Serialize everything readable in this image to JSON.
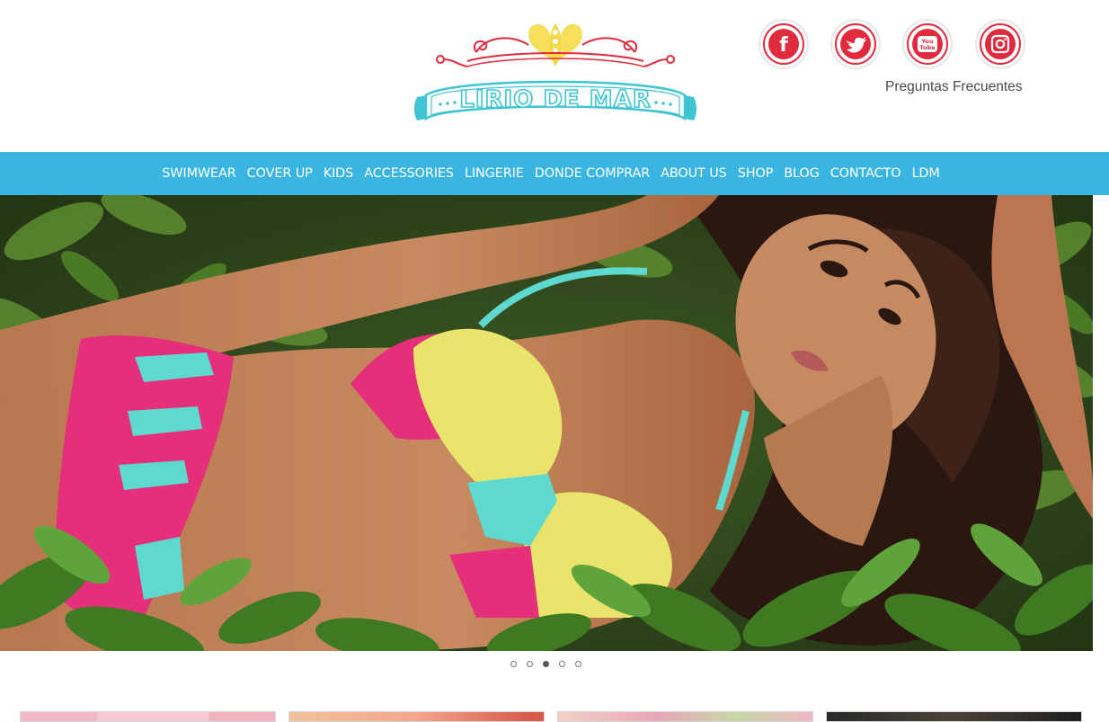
{
  "brand": {
    "logo_text": "LIRIO DE MAR",
    "colors": {
      "red": "#e02b3f",
      "yellow": "#f6e05b",
      "turquoise": "#3fc4d2"
    }
  },
  "social": [
    {
      "icon": "facebook-icon",
      "label": "f"
    },
    {
      "icon": "twitter-icon",
      "label": ""
    },
    {
      "icon": "youtube-icon",
      "label": "You Tube"
    },
    {
      "icon": "instagram-icon",
      "label": ""
    }
  ],
  "faq_link": "Preguntas Frecuentes",
  "nav": {
    "background": "#3ab5e1",
    "items": [
      "SWIMWEAR",
      "COVER UP",
      "KIDS",
      "ACCESSORIES",
      "LINGERIE",
      "DONDE COMPRAR",
      "ABOUT US",
      "SHOP",
      "BLOG",
      "CONTACTO",
      "LDM"
    ]
  },
  "slider": {
    "slide_count": 5,
    "active_index": 2
  },
  "thumbnails": [
    {
      "name": "thumb-1"
    },
    {
      "name": "thumb-2"
    },
    {
      "name": "thumb-3"
    },
    {
      "name": "thumb-4"
    }
  ]
}
